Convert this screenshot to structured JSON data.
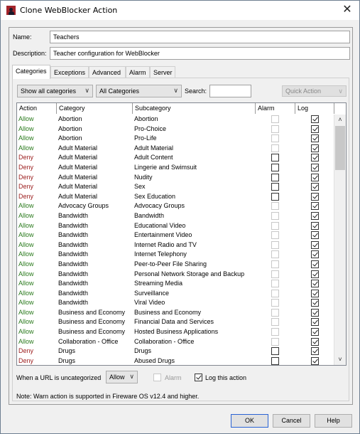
{
  "window": {
    "title": "Clone WebBlocker Action",
    "icon": "webblocker-app-icon",
    "close_glyph": "✕"
  },
  "form": {
    "name_label": "Name:",
    "name_value": "Teachers",
    "description_label": "Description:",
    "description_value": "Teacher configuration for WebBlocker"
  },
  "tabs": [
    {
      "label": "Categories",
      "active": true
    },
    {
      "label": "Exceptions",
      "active": false
    },
    {
      "label": "Advanced",
      "active": false
    },
    {
      "label": "Alarm",
      "active": false
    },
    {
      "label": "Server",
      "active": false
    }
  ],
  "filters": {
    "show_select": "Show all categories",
    "category_select": "All Categories",
    "search_label": "Search:",
    "search_value": "",
    "quick_action": "Quick Action",
    "chevron_glyph": "∨"
  },
  "table": {
    "columns": [
      "Action",
      "Category",
      "Subcategory",
      "Alarm",
      "Log"
    ],
    "rows": [
      {
        "action": "Allow",
        "category": "Abortion",
        "subcategory": "Abortion",
        "alarm": false,
        "alarm_enabled": false,
        "log": true
      },
      {
        "action": "Allow",
        "category": "Abortion",
        "subcategory": "Pro-Choice",
        "alarm": false,
        "alarm_enabled": false,
        "log": true
      },
      {
        "action": "Allow",
        "category": "Abortion",
        "subcategory": "Pro-Life",
        "alarm": false,
        "alarm_enabled": false,
        "log": true
      },
      {
        "action": "Allow",
        "category": "Adult Material",
        "subcategory": "Adult Material",
        "alarm": false,
        "alarm_enabled": false,
        "log": true
      },
      {
        "action": "Deny",
        "category": "Adult Material",
        "subcategory": "Adult Content",
        "alarm": false,
        "alarm_enabled": true,
        "log": true
      },
      {
        "action": "Deny",
        "category": "Adult Material",
        "subcategory": "Lingerie and Swimsuit",
        "alarm": false,
        "alarm_enabled": true,
        "log": true
      },
      {
        "action": "Deny",
        "category": "Adult Material",
        "subcategory": "Nudity",
        "alarm": false,
        "alarm_enabled": true,
        "log": true
      },
      {
        "action": "Deny",
        "category": "Adult Material",
        "subcategory": "Sex",
        "alarm": false,
        "alarm_enabled": true,
        "log": true
      },
      {
        "action": "Deny",
        "category": "Adult Material",
        "subcategory": "Sex Education",
        "alarm": false,
        "alarm_enabled": true,
        "log": true
      },
      {
        "action": "Allow",
        "category": "Advocacy Groups",
        "subcategory": "Advocacy Groups",
        "alarm": false,
        "alarm_enabled": false,
        "log": true
      },
      {
        "action": "Allow",
        "category": "Bandwidth",
        "subcategory": "Bandwidth",
        "alarm": false,
        "alarm_enabled": false,
        "log": true
      },
      {
        "action": "Allow",
        "category": "Bandwidth",
        "subcategory": "Educational Video",
        "alarm": false,
        "alarm_enabled": false,
        "log": true
      },
      {
        "action": "Allow",
        "category": "Bandwidth",
        "subcategory": "Entertainment Video",
        "alarm": false,
        "alarm_enabled": false,
        "log": true
      },
      {
        "action": "Allow",
        "category": "Bandwidth",
        "subcategory": "Internet Radio and TV",
        "alarm": false,
        "alarm_enabled": false,
        "log": true
      },
      {
        "action": "Allow",
        "category": "Bandwidth",
        "subcategory": "Internet Telephony",
        "alarm": false,
        "alarm_enabled": false,
        "log": true
      },
      {
        "action": "Allow",
        "category": "Bandwidth",
        "subcategory": "Peer-to-Peer File Sharing",
        "alarm": false,
        "alarm_enabled": false,
        "log": true
      },
      {
        "action": "Allow",
        "category": "Bandwidth",
        "subcategory": "Personal Network Storage and Backup",
        "alarm": false,
        "alarm_enabled": false,
        "log": true
      },
      {
        "action": "Allow",
        "category": "Bandwidth",
        "subcategory": "Streaming Media",
        "alarm": false,
        "alarm_enabled": false,
        "log": true
      },
      {
        "action": "Allow",
        "category": "Bandwidth",
        "subcategory": "Surveillance",
        "alarm": false,
        "alarm_enabled": false,
        "log": true
      },
      {
        "action": "Allow",
        "category": "Bandwidth",
        "subcategory": "Viral Video",
        "alarm": false,
        "alarm_enabled": false,
        "log": true
      },
      {
        "action": "Allow",
        "category": "Business and Economy",
        "subcategory": "Business and Economy",
        "alarm": false,
        "alarm_enabled": false,
        "log": true
      },
      {
        "action": "Allow",
        "category": "Business and Economy",
        "subcategory": "Financial Data and Services",
        "alarm": false,
        "alarm_enabled": false,
        "log": true
      },
      {
        "action": "Allow",
        "category": "Business and Economy",
        "subcategory": "Hosted Business Applications",
        "alarm": false,
        "alarm_enabled": false,
        "log": true
      },
      {
        "action": "Allow",
        "category": "Collaboration - Office",
        "subcategory": "Collaboration - Office",
        "alarm": false,
        "alarm_enabled": false,
        "log": true
      },
      {
        "action": "Deny",
        "category": "Drugs",
        "subcategory": "Drugs",
        "alarm": false,
        "alarm_enabled": true,
        "log": true
      },
      {
        "action": "Deny",
        "category": "Drugs",
        "subcategory": "Abused Drugs",
        "alarm": false,
        "alarm_enabled": true,
        "log": true
      }
    ],
    "scroll_up_glyph": "˄",
    "scroll_down_glyph": "˅"
  },
  "uncategorized": {
    "label": "When a URL is uncategorized",
    "action_value": "Allow",
    "alarm_label": "Alarm",
    "alarm_checked": false,
    "alarm_enabled": false,
    "log_label": "Log this action",
    "log_checked": true
  },
  "note": "Note: Warn action is supported in Fireware OS v12.4 and higher.",
  "buttons": {
    "ok": "OK",
    "cancel": "Cancel",
    "help": "Help"
  },
  "colors": {
    "allow": "#2a7a1c",
    "deny": "#9a1a1a",
    "default_button_border": "#2a63d4",
    "app_icon": "#a3242a"
  }
}
